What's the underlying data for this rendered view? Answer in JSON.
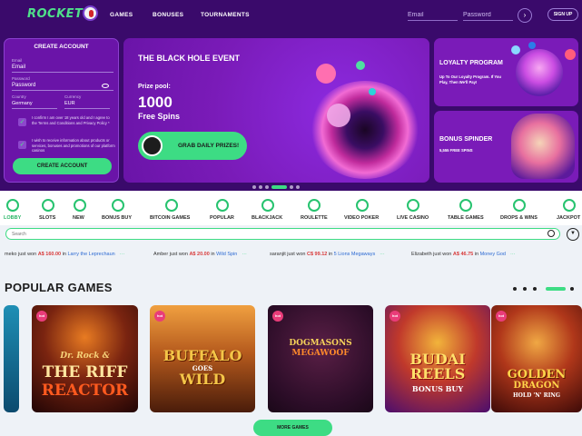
{
  "header": {
    "logo": "ROCKET",
    "nav": [
      "GAMES",
      "BONUSES",
      "TOURNAMENTS"
    ],
    "email_placeholder": "Email",
    "password_placeholder": "Password",
    "go_symbol": "›",
    "signup_label": "SIGN UP"
  },
  "create_account": {
    "title": "CREATE ACCOUNT",
    "email_label": "Email",
    "email_value": "Email",
    "password_label": "Password",
    "password_value": "Password",
    "country_label": "Country",
    "country_value": "Germany",
    "currency_label": "Currency",
    "currency_value": "EUR",
    "terms_text": "I confirm I am over 18 years old and I agree to the Terms and Conditions and Privacy Policy *",
    "promo_text": "I wish to receive information about products or services, bonuses and promotions of our platform casinos",
    "button": "CREATE ACCOUNT"
  },
  "hero": {
    "title": "THE BLACK HOLE EVENT",
    "prize_label": "Prize pool:",
    "amount": "1000",
    "spins": "Free Spins",
    "button": "GRAB DAILY PRIZES!"
  },
  "loyalty": {
    "title": "LOYALTY PROGRAM",
    "subtitle": "Up To Our Loyalty Program. If You Play, Then We'll Pay!"
  },
  "bonus_spinder": {
    "title": "BONUS SPINDER",
    "subtitle": "5,555 FREE SPINS"
  },
  "slider": {
    "dot_count": 6,
    "active_index": 3
  },
  "categories": [
    {
      "label": "LOBBY",
      "icon": "lobby-icon",
      "active": true
    },
    {
      "label": "SLOTS",
      "icon": "slots-icon",
      "active": false
    },
    {
      "label": "NEW",
      "icon": "new-icon",
      "active": false
    },
    {
      "label": "BONUS BUY",
      "icon": "bonus-buy-icon",
      "active": false
    },
    {
      "label": "BITCOIN GAMES",
      "icon": "bitcoin-icon",
      "active": false
    },
    {
      "label": "POPULAR",
      "icon": "popular-icon",
      "active": false
    },
    {
      "label": "BLACKJACK",
      "icon": "blackjack-icon",
      "active": false
    },
    {
      "label": "ROULETTE",
      "icon": "roulette-icon",
      "active": false
    },
    {
      "label": "VIDEO POKER",
      "icon": "video-poker-icon",
      "active": false
    },
    {
      "label": "LIVE CASINO",
      "icon": "live-casino-icon",
      "active": false
    },
    {
      "label": "TABLE GAMES",
      "icon": "table-games-icon",
      "active": false
    },
    {
      "label": "DROPS & WINS",
      "icon": "drops-wins-icon",
      "active": false
    },
    {
      "label": "JACKPOT",
      "icon": "jackpot-icon",
      "active": false
    }
  ],
  "search": {
    "placeholder": "Search"
  },
  "ticker": [
    {
      "user": "meko",
      "text": "just won",
      "amount": "A$ 160.00",
      "in": "in",
      "game": "Larry the Leprechaun"
    },
    {
      "user": "Amber",
      "text": "just won",
      "amount": "A$ 20.00",
      "in": "in",
      "game": "Wild Spin"
    },
    {
      "user": "saranjit",
      "text": "just won",
      "amount": "C$ 99.12",
      "in": "in",
      "game": "5 Lions Megaways"
    },
    {
      "user": "Elizabeth",
      "text": "just won",
      "amount": "A$ 46.75",
      "in": "in",
      "game": "Money God"
    }
  ],
  "popular": {
    "title": "POPULAR GAMES",
    "games": [
      {
        "line1": "Dr. Rock &",
        "line2": "THE RIFF",
        "line3": "REACTOR",
        "badge": "hot"
      },
      {
        "line1": "BUFFALO",
        "line2": "GOES",
        "line3": "WILD",
        "badge": "hot"
      },
      {
        "line1": "DOGMASONS",
        "line2": "MEGAWOOF",
        "line3": "",
        "badge": "hot"
      },
      {
        "line1": "BUDAI",
        "line2": "REELS",
        "line3": "BONUS BUY",
        "badge": "hot"
      },
      {
        "line1": "GOLDEN",
        "line2": "DRAGON",
        "line3": "HOLD 'N' RING",
        "badge": "hot"
      }
    ],
    "more_button": "MORE GAMES"
  },
  "colors": {
    "brand_green": "#3ddc84",
    "header_purple": "#3a0a6b",
    "card_purple": "#7a1bb8"
  }
}
